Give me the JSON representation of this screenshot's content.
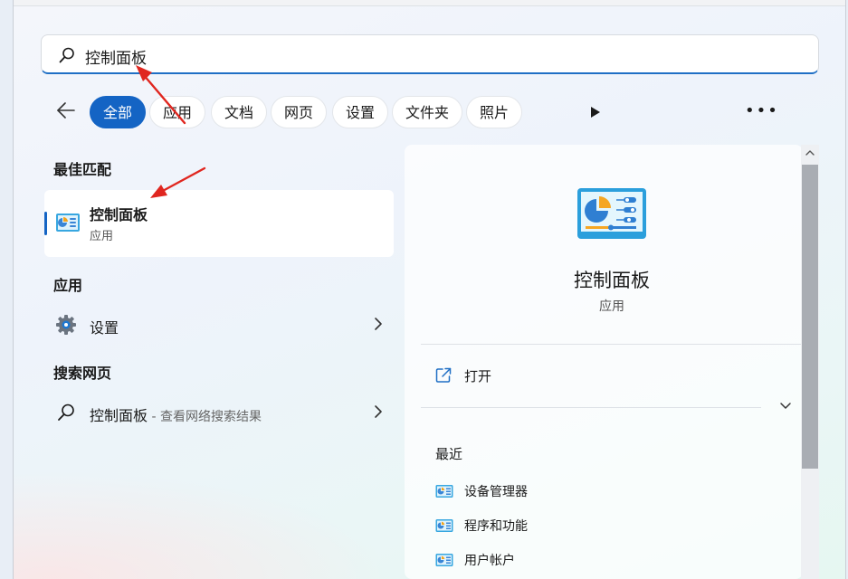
{
  "search": {
    "value": "控制面板"
  },
  "filters": {
    "chips": [
      "全部",
      "应用",
      "文档",
      "网页",
      "设置",
      "文件夹",
      "照片"
    ],
    "active": "全部"
  },
  "left": {
    "best_match": {
      "title": "最佳匹配",
      "name": "控制面板",
      "sub": "应用"
    },
    "apps": {
      "title": "应用",
      "items": [
        {
          "label": "设置"
        }
      ]
    },
    "web": {
      "title": "搜索网页",
      "items": [
        {
          "label": "控制面板",
          "hint": " - 查看网络搜索结果"
        }
      ]
    }
  },
  "detail": {
    "name": "控制面板",
    "sub": "应用",
    "open_label": "打开",
    "recent_title": "最近",
    "recent": [
      "设备管理器",
      "程序和功能",
      "用户帐户"
    ]
  },
  "icons": {
    "search": "search-icon",
    "back": "back-arrow-icon",
    "play": "play-icon",
    "more": "more-icon",
    "control_panel": "control-panel-icon",
    "settings": "gear-icon",
    "open": "open-external-icon"
  },
  "colors": {
    "accent": "#1464c4",
    "annotation": "#e0261f"
  }
}
